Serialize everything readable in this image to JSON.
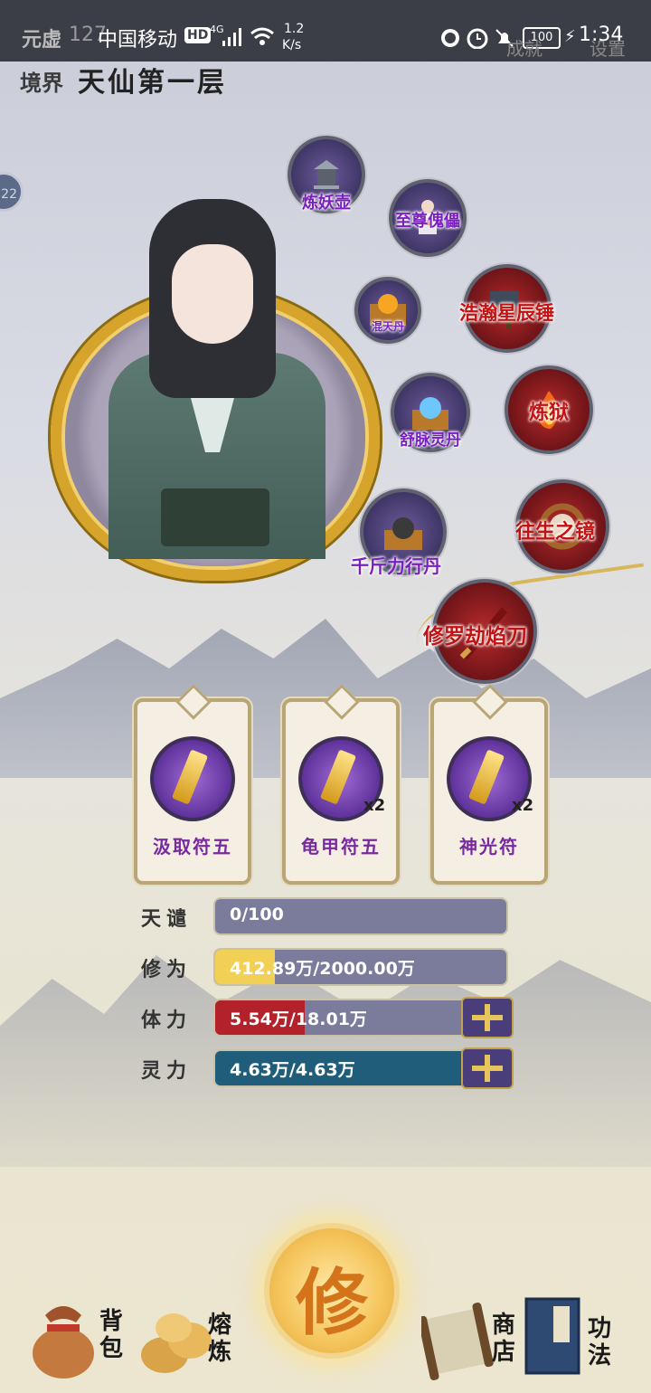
{
  "status_bar": {
    "carrier": "中国移动",
    "hd": "HD",
    "network": "4G",
    "speed_value": "1.2",
    "speed_unit": "K/s",
    "battery": "100",
    "time": "1:34"
  },
  "header": {
    "top_label_partial": "元虚",
    "top_value_partial": "127",
    "realm_label": "境界",
    "realm_value": "天仙第一层",
    "top_right_1": "成就",
    "top_right_2": "设置",
    "side_badge": "22"
  },
  "skills": [
    {
      "name": "炼妖壶",
      "style": "purple"
    },
    {
      "name": "至尊傀儡",
      "style": "purple"
    },
    {
      "name": "混天丹",
      "style": "purple"
    },
    {
      "name": "浩瀚星辰锤",
      "style": "red"
    },
    {
      "name": "舒脉灵丹",
      "style": "purple"
    },
    {
      "name": "炼狱",
      "style": "red"
    },
    {
      "name": "千斤力行丹",
      "style": "purple"
    },
    {
      "name": "往生之镜",
      "style": "red"
    },
    {
      "name": "修罗劫焰刀",
      "style": "red"
    }
  ],
  "talismans": [
    {
      "name": "汲取符五",
      "qty": ""
    },
    {
      "name": "龟甲符五",
      "qty": "x2"
    },
    {
      "name": "神光符",
      "qty": "x2"
    }
  ],
  "stats": {
    "tianqian": {
      "label": "天谴",
      "text": "0/100",
      "fraction": 0.0
    },
    "xiuwei": {
      "label": "修为",
      "text": "412.89万/2000.00万",
      "fraction": 0.206
    },
    "tili": {
      "label": "体力",
      "text": "5.54万/18.01万",
      "fraction": 0.308
    },
    "lingli": {
      "label": "灵力",
      "text": "4.63万/4.63万",
      "fraction": 1.0
    }
  },
  "colors": {
    "xiuwei_fill": "#f2cf55",
    "tili_fill": "#b3222a",
    "lingli_fill": "#1f5d7a",
    "bar_bg": "#7b7c9c"
  },
  "nav": {
    "bag": "背包",
    "smelt": "熔炼",
    "cultivate": "修",
    "shop": "商店",
    "skills": "功法"
  }
}
